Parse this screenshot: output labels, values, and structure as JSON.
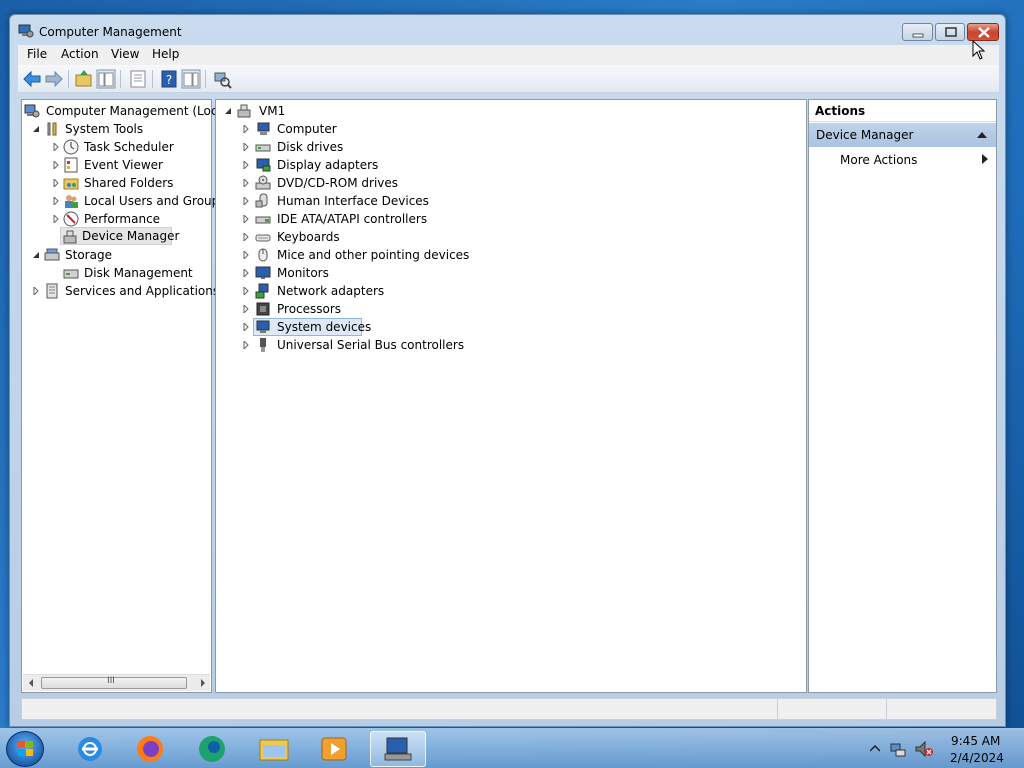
{
  "window": {
    "title": "Computer Management"
  },
  "menu": [
    "File",
    "Action",
    "View",
    "Help"
  ],
  "left_tree": {
    "root": "Computer Management (Local",
    "system_tools": "System Tools",
    "items": [
      "Task Scheduler",
      "Event Viewer",
      "Shared Folders",
      "Local Users and Groups",
      "Performance",
      "Device Manager"
    ],
    "storage": "Storage",
    "disk_management": "Disk Management",
    "services": "Services and Applications",
    "scroll_glyph": "III"
  },
  "device_tree": {
    "root": "VM1",
    "categories": [
      "Computer",
      "Disk drives",
      "Display adapters",
      "DVD/CD-ROM drives",
      "Human Interface Devices",
      "IDE ATA/ATAPI controllers",
      "Keyboards",
      "Mice and other pointing devices",
      "Monitors",
      "Network adapters",
      "Processors",
      "System devices",
      "Universal Serial Bus controllers"
    ],
    "selected": "System devices"
  },
  "actions": {
    "header": "Actions",
    "section": "Device Manager",
    "more": "More Actions"
  },
  "taskbar": {
    "time": "9:45 AM",
    "date": "2/4/2024"
  },
  "colors": {
    "desktop": "#1d6bb8",
    "selection": "#dde9f7",
    "actions_header": "#b4cbe5"
  }
}
